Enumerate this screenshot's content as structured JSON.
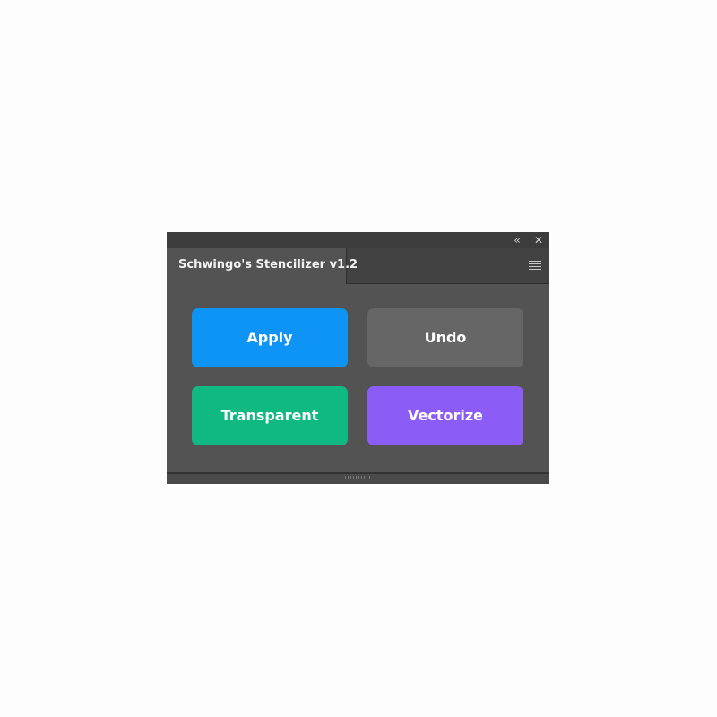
{
  "panel": {
    "title": "Schwingo's Stencilizer v1.2",
    "collapse_glyph": "‹‹",
    "close_glyph": "✕",
    "menu_icon": "hamburger-icon"
  },
  "buttons": {
    "apply": {
      "label": "Apply",
      "color": "#0e94f5"
    },
    "undo": {
      "label": "Undo",
      "color": "#666666"
    },
    "transparent": {
      "label": "Transparent",
      "color": "#10b981"
    },
    "vectorize": {
      "label": "Vectorize",
      "color": "#8b5cf6"
    }
  },
  "colors": {
    "panel_bg": "#535353",
    "titlebar_bg": "#3c3c3c",
    "page_bg": "#fdfdfd"
  }
}
